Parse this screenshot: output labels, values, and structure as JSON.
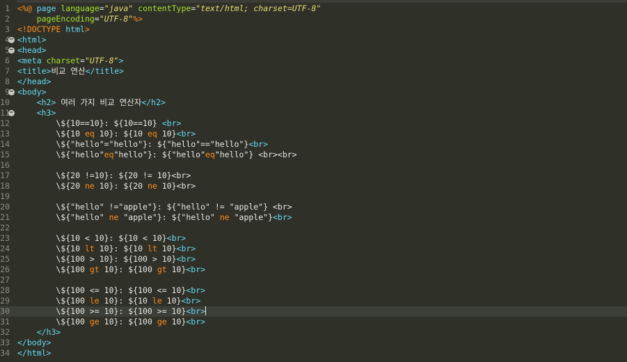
{
  "colors": {
    "background": "#2f3129",
    "line_number": "#8a8c82",
    "current_line": "#3c3e38",
    "text": "#e8e8e3",
    "tag": "#66d9ef",
    "attr": "#a6e22e",
    "string": "#e6db74",
    "keyword": "#ff8c1a",
    "directive": "#ff8c1a"
  },
  "editor": {
    "current_line": 30,
    "lines": [
      {
        "num": "1",
        "fold": false,
        "tokens": [
          {
            "t": "<%@",
            "c": "directive"
          },
          {
            "t": " ",
            "c": "text"
          },
          {
            "t": "page",
            "c": "tag"
          },
          {
            "t": " ",
            "c": "text"
          },
          {
            "t": "language",
            "c": "attr"
          },
          {
            "t": "=",
            "c": "text"
          },
          {
            "t": "\"java\"",
            "c": "string",
            "i": true
          },
          {
            "t": " ",
            "c": "text"
          },
          {
            "t": "contentType",
            "c": "attr"
          },
          {
            "t": "=",
            "c": "text"
          },
          {
            "t": "\"text/html; charset=UTF-8\"",
            "c": "string",
            "i": true
          }
        ]
      },
      {
        "num": "2",
        "fold": false,
        "tokens": [
          {
            "t": "    ",
            "c": "text"
          },
          {
            "t": "pageEncoding",
            "c": "attr"
          },
          {
            "t": "=",
            "c": "text"
          },
          {
            "t": "\"UTF-8\"",
            "c": "string",
            "i": true
          },
          {
            "t": "%>",
            "c": "directive"
          }
        ]
      },
      {
        "num": "3",
        "fold": false,
        "tokens": [
          {
            "t": "<!DOCTYPE ",
            "c": "directive"
          },
          {
            "t": "html",
            "c": "tag"
          },
          {
            "t": ">",
            "c": "directive"
          }
        ]
      },
      {
        "num": "4",
        "fold": true,
        "tokens": [
          {
            "t": "<html>",
            "c": "tag"
          }
        ]
      },
      {
        "num": "5",
        "fold": true,
        "tokens": [
          {
            "t": "<head>",
            "c": "tag"
          }
        ]
      },
      {
        "num": "6",
        "fold": false,
        "tokens": [
          {
            "t": "<meta",
            "c": "tag"
          },
          {
            "t": " ",
            "c": "text"
          },
          {
            "t": "charset",
            "c": "attr"
          },
          {
            "t": "=",
            "c": "text"
          },
          {
            "t": "\"UTF-8\"",
            "c": "string",
            "i": true
          },
          {
            "t": ">",
            "c": "tag"
          }
        ]
      },
      {
        "num": "7",
        "fold": false,
        "tokens": [
          {
            "t": "<title>",
            "c": "tag"
          },
          {
            "t": "비교 연산",
            "c": "text"
          },
          {
            "t": "</title>",
            "c": "tag"
          }
        ]
      },
      {
        "num": "8",
        "fold": false,
        "tokens": [
          {
            "t": "</head>",
            "c": "tag"
          }
        ]
      },
      {
        "num": "9",
        "fold": true,
        "tokens": [
          {
            "t": "<body>",
            "c": "tag"
          }
        ]
      },
      {
        "num": "10",
        "fold": false,
        "tokens": [
          {
            "t": "    ",
            "c": "text"
          },
          {
            "t": "<h2>",
            "c": "tag"
          },
          {
            "t": " 여러 가지 비교 연산자",
            "c": "text"
          },
          {
            "t": "</h2>",
            "c": "tag"
          }
        ]
      },
      {
        "num": "11",
        "fold": true,
        "tokens": [
          {
            "t": "    ",
            "c": "text"
          },
          {
            "t": "<h3>",
            "c": "tag"
          }
        ]
      },
      {
        "num": "12",
        "fold": false,
        "tokens": [
          {
            "t": "        \\${10==10}: ${10==10} ",
            "c": "text"
          },
          {
            "t": "<br>",
            "c": "tag"
          }
        ]
      },
      {
        "num": "13",
        "fold": false,
        "tokens": [
          {
            "t": "        \\${10 ",
            "c": "text"
          },
          {
            "t": "eq",
            "c": "keyword"
          },
          {
            "t": " 10}: ${10 ",
            "c": "text"
          },
          {
            "t": "eq",
            "c": "keyword"
          },
          {
            "t": " 10}",
            "c": "text"
          },
          {
            "t": "<br>",
            "c": "tag"
          }
        ]
      },
      {
        "num": "14",
        "fold": false,
        "tokens": [
          {
            "t": "        \\${\"hello\"=\"hello\"}: ${\"hello\"==\"hello\"}",
            "c": "text"
          },
          {
            "t": "<br>",
            "c": "tag"
          }
        ]
      },
      {
        "num": "15",
        "fold": false,
        "tokens": [
          {
            "t": "        \\${\"hello\"",
            "c": "text"
          },
          {
            "t": "eq",
            "c": "keyword"
          },
          {
            "t": "\"hello\"}: ${\"hello\"",
            "c": "text"
          },
          {
            "t": "eq",
            "c": "keyword"
          },
          {
            "t": "\"hello\"} <br><br>",
            "c": "text"
          }
        ]
      },
      {
        "num": "16",
        "fold": false,
        "tokens": []
      },
      {
        "num": "17",
        "fold": false,
        "tokens": [
          {
            "t": "        \\${20 !=10}: ${20 != 10}<br>",
            "c": "text"
          }
        ]
      },
      {
        "num": "18",
        "fold": false,
        "tokens": [
          {
            "t": "        \\${20 ",
            "c": "text"
          },
          {
            "t": "ne",
            "c": "keyword"
          },
          {
            "t": " 10}: ${20 ",
            "c": "text"
          },
          {
            "t": "ne",
            "c": "keyword"
          },
          {
            "t": " 10}<br>",
            "c": "text"
          }
        ]
      },
      {
        "num": "19",
        "fold": false,
        "tokens": []
      },
      {
        "num": "20",
        "fold": false,
        "tokens": [
          {
            "t": "        \\${\"hello\" !=\"apple\"}: ${\"hello\" != \"apple\"} <br>",
            "c": "text"
          }
        ]
      },
      {
        "num": "21",
        "fold": false,
        "tokens": [
          {
            "t": "        \\${\"hello\" ",
            "c": "text"
          },
          {
            "t": "ne",
            "c": "keyword"
          },
          {
            "t": " \"apple\"}: ${\"hello\" ",
            "c": "text"
          },
          {
            "t": "ne",
            "c": "keyword"
          },
          {
            "t": " \"apple\"}",
            "c": "text"
          },
          {
            "t": "<br>",
            "c": "tag"
          }
        ]
      },
      {
        "num": "22",
        "fold": false,
        "tokens": []
      },
      {
        "num": "23",
        "fold": false,
        "tokens": [
          {
            "t": "        \\${10 < 10}: ${10 < 10}",
            "c": "text"
          },
          {
            "t": "<br>",
            "c": "tag"
          }
        ]
      },
      {
        "num": "24",
        "fold": false,
        "tokens": [
          {
            "t": "        \\${10 ",
            "c": "text"
          },
          {
            "t": "lt",
            "c": "keyword"
          },
          {
            "t": " 10}: ${10 ",
            "c": "text"
          },
          {
            "t": "lt",
            "c": "keyword"
          },
          {
            "t": " 10}",
            "c": "text"
          },
          {
            "t": "<br>",
            "c": "tag"
          }
        ]
      },
      {
        "num": "25",
        "fold": false,
        "tokens": [
          {
            "t": "        \\${100 > 10}: ${100 > 10}",
            "c": "text"
          },
          {
            "t": "<br>",
            "c": "tag"
          }
        ]
      },
      {
        "num": "26",
        "fold": false,
        "tokens": [
          {
            "t": "        \\${100 ",
            "c": "text"
          },
          {
            "t": "gt",
            "c": "keyword"
          },
          {
            "t": " 10}: ${100 ",
            "c": "text"
          },
          {
            "t": "gt",
            "c": "keyword"
          },
          {
            "t": " 10}",
            "c": "text"
          },
          {
            "t": "<br>",
            "c": "tag"
          }
        ]
      },
      {
        "num": "27",
        "fold": false,
        "tokens": []
      },
      {
        "num": "28",
        "fold": false,
        "tokens": [
          {
            "t": "        \\${100 <= 10}: ${100 <= 10}",
            "c": "text"
          },
          {
            "t": "<br>",
            "c": "tag"
          }
        ]
      },
      {
        "num": "29",
        "fold": false,
        "tokens": [
          {
            "t": "        \\${100 ",
            "c": "text"
          },
          {
            "t": "le",
            "c": "keyword"
          },
          {
            "t": " 10}: ${10 ",
            "c": "text"
          },
          {
            "t": "le",
            "c": "keyword"
          },
          {
            "t": " 10}",
            "c": "text"
          },
          {
            "t": "<br>",
            "c": "tag"
          }
        ]
      },
      {
        "num": "30",
        "fold": false,
        "tokens": [
          {
            "t": "        \\${100 >= 10}: ${100 >= 10}",
            "c": "text"
          },
          {
            "t": "<br>",
            "c": "tag"
          },
          {
            "t": "|",
            "c": "cursor"
          }
        ]
      },
      {
        "num": "31",
        "fold": false,
        "tokens": [
          {
            "t": "        \\${100 ",
            "c": "text"
          },
          {
            "t": "ge",
            "c": "keyword"
          },
          {
            "t": " 10}: ${100 ",
            "c": "text"
          },
          {
            "t": "ge",
            "c": "keyword"
          },
          {
            "t": " 10}",
            "c": "text"
          },
          {
            "t": "<br>",
            "c": "tag"
          }
        ]
      },
      {
        "num": "32",
        "fold": false,
        "tokens": [
          {
            "t": "    ",
            "c": "text"
          },
          {
            "t": "</h3>",
            "c": "tag"
          }
        ]
      },
      {
        "num": "33",
        "fold": false,
        "tokens": [
          {
            "t": "</body>",
            "c": "tag"
          }
        ]
      },
      {
        "num": "34",
        "fold": false,
        "tokens": [
          {
            "t": "</html>",
            "c": "tag"
          }
        ]
      }
    ]
  }
}
